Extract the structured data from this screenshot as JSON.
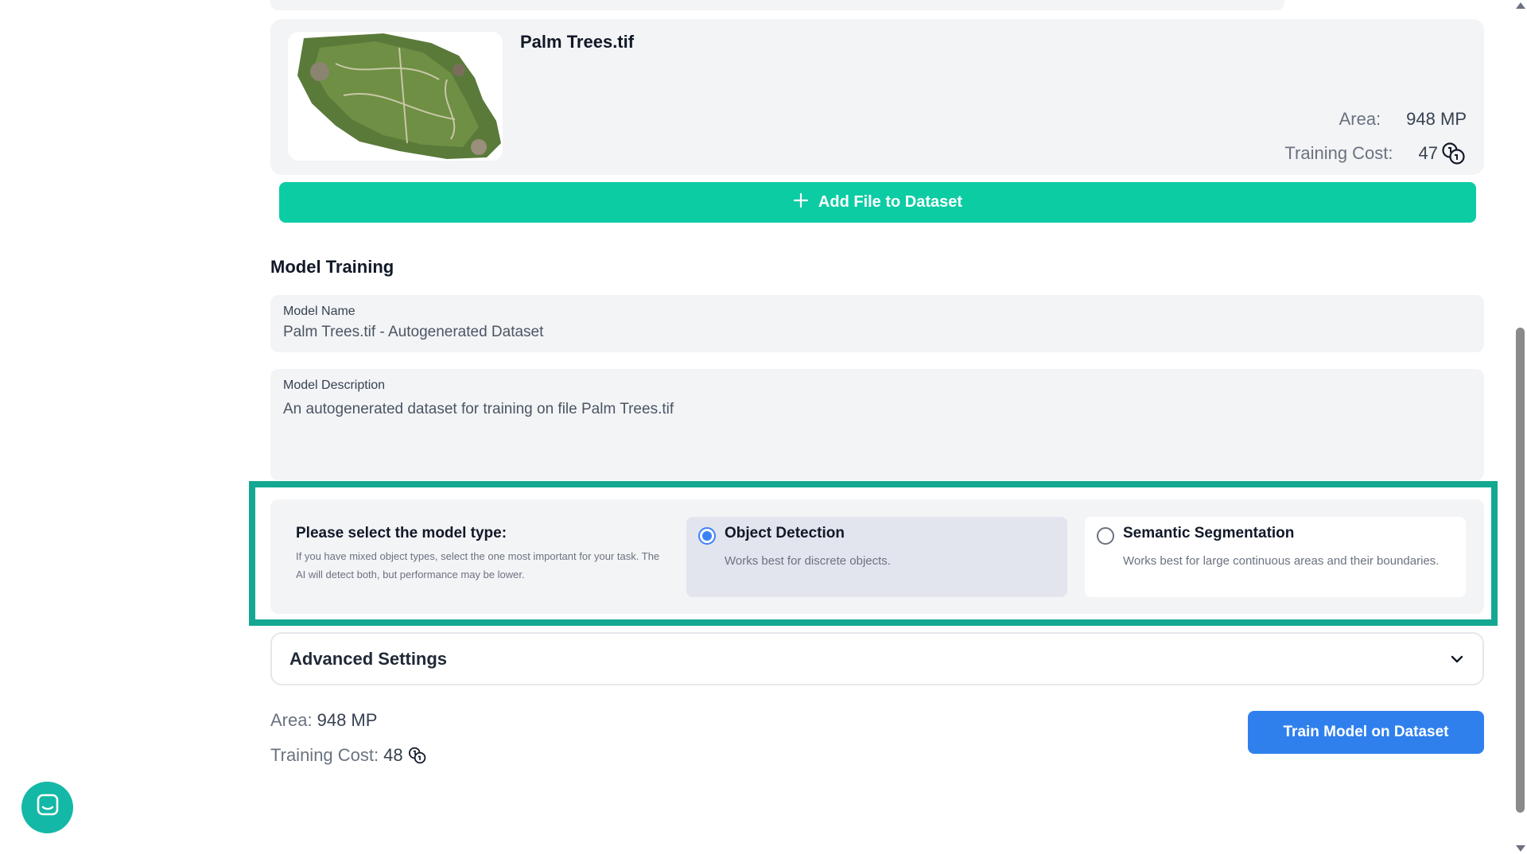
{
  "file_card": {
    "name": "Palm Trees.tif",
    "area_label": "Area:",
    "area_value": "948 MP",
    "cost_label": "Training Cost:",
    "cost_value": "47",
    "thumbnail_icon": "aerial-map-thumbnail"
  },
  "add_file_button": {
    "label": "Add File to Dataset",
    "icon": "plus-icon"
  },
  "model_training": {
    "title": "Model Training",
    "name_field": {
      "label": "Model Name",
      "value": "Palm Trees.tif - Autogenerated Dataset"
    },
    "description_field": {
      "label": "Model Description",
      "value": "An autogenerated dataset for training on file Palm Trees.tif"
    }
  },
  "model_type": {
    "prompt_title": "Please select the model type:",
    "prompt_help": "If you have mixed object types, select the one most important for your task. The AI will detect both, but performance may be lower.",
    "options": [
      {
        "title": "Object Detection",
        "description": "Works best for discrete objects.",
        "selected": true
      },
      {
        "title": "Semantic Segmentation",
        "description": "Works best for large continuous areas and their boundaries.",
        "selected": false
      }
    ]
  },
  "advanced_settings": {
    "label": "Advanced Settings",
    "icon": "chevron-down-icon"
  },
  "summary": {
    "area_label": "Area:",
    "area_value": "948 MP",
    "cost_label": "Training Cost:",
    "cost_value": "48"
  },
  "train_button": {
    "label": "Train Model on Dataset"
  },
  "colors": {
    "accent_teal": "#0ccca4",
    "highlight_border": "#14a892",
    "primary_blue": "#2f80ed",
    "radio_selected": "#3b82f6"
  }
}
